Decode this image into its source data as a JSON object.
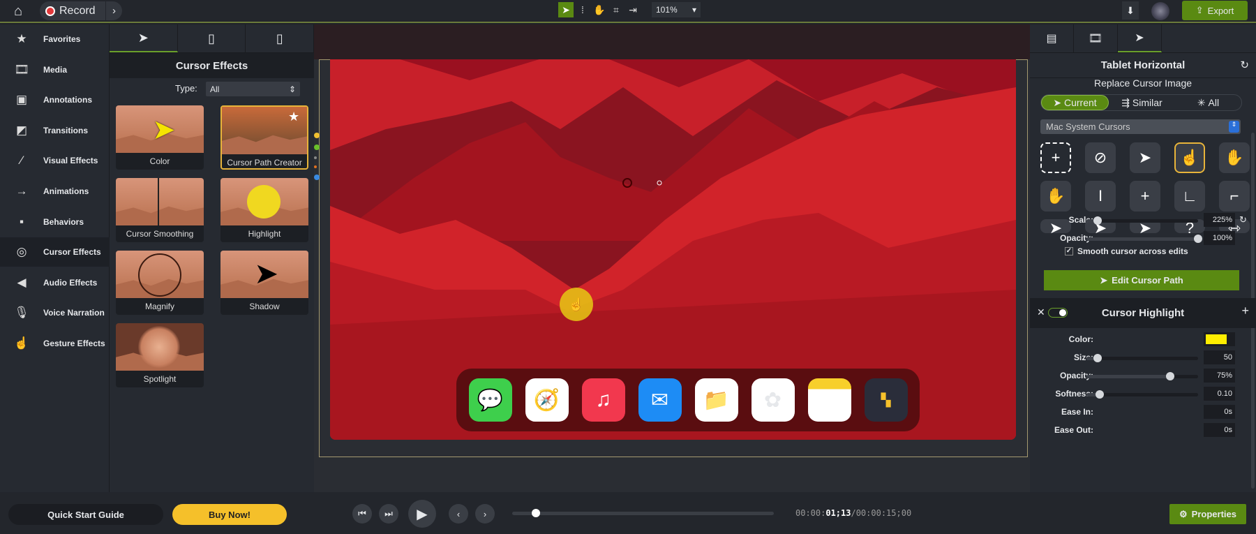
{
  "topbar": {
    "record_label": "Record",
    "zoom": "101%",
    "export_label": "Export"
  },
  "sidebar": {
    "items": [
      {
        "label": "Favorites",
        "icon": "★"
      },
      {
        "label": "Media",
        "icon": "🎞"
      },
      {
        "label": "Annotations",
        "icon": "▣"
      },
      {
        "label": "Transitions",
        "icon": "◩"
      },
      {
        "label": "Visual Effects",
        "icon": "⁄"
      },
      {
        "label": "Animations",
        "icon": "→"
      },
      {
        "label": "Behaviors",
        "icon": "▪"
      },
      {
        "label": "Cursor Effects",
        "icon": "◎"
      },
      {
        "label": "Audio Effects",
        "icon": "◀"
      },
      {
        "label": "Voice Narration",
        "icon": "🎙"
      },
      {
        "label": "Gesture Effects",
        "icon": "☝"
      }
    ]
  },
  "effects": {
    "title": "Cursor Effects",
    "type_label": "Type:",
    "type_value": "All",
    "tiles": [
      "Color",
      "Cursor Path Creator",
      "Cursor Smoothing",
      "Highlight",
      "Magnify",
      "Shadow",
      "Spotlight"
    ]
  },
  "properties": {
    "title": "Tablet Horizontal",
    "subtitle": "Replace Cursor Image",
    "segments": [
      "Current",
      "Similar",
      "All"
    ],
    "library": "Mac System Cursors",
    "scale_label": "Scale:",
    "scale_value": "225%",
    "scale_level": 0.1,
    "opacity_label": "Opacity:",
    "opacity_value": "100%",
    "opacity_level": 1.0,
    "smooth_label": "Smooth cursor across edits",
    "smooth_checked": true,
    "edit_path_label": "Edit Cursor Path",
    "highlight": {
      "title": "Cursor Highlight",
      "enabled": true,
      "color_label": "Color:",
      "color": "#ffee00",
      "size_label": "Size:",
      "size_value": "50",
      "size_level": 0.1,
      "opacity_label": "Opacity:",
      "opacity_value": "75%",
      "opacity_level": 0.75,
      "softness_label": "Softness:",
      "softness_value": "0.10",
      "softness_level": 0.12,
      "ease_in_label": "Ease In:",
      "ease_in_value": "0s",
      "ease_out_label": "Ease Out:",
      "ease_out_value": "0s"
    }
  },
  "bottom": {
    "quick_start": "Quick Start Guide",
    "buy_now": "Buy Now!",
    "time_prefix": "00:00:",
    "time_current": "01;13",
    "time_total": "/00:00:15;00",
    "progress": 0.09,
    "properties_label": "Properties"
  }
}
